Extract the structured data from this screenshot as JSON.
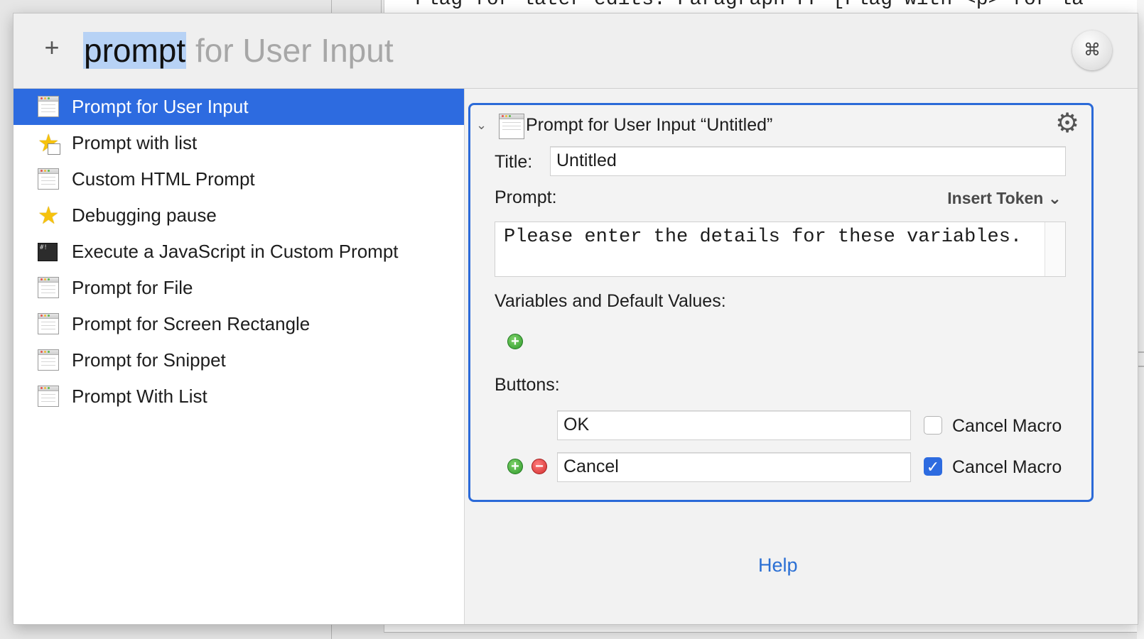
{
  "background": {
    "editor_line": "Flag for later edits: Paragraph  FP    [Flag with <p> for la"
  },
  "search": {
    "plus_label": "+",
    "typed": "prompt",
    "completion": " for User Input"
  },
  "app_icon_glyph": "⌘",
  "actions": [
    {
      "label": "Prompt for User Input",
      "icon": "window-icon",
      "selected": true
    },
    {
      "label": "Prompt with list",
      "icon": "star-icon",
      "selected": false
    },
    {
      "label": "Custom HTML Prompt",
      "icon": "window-icon",
      "selected": false
    },
    {
      "label": "Debugging pause",
      "icon": "star-icon",
      "selected": false
    },
    {
      "label": "Execute a JavaScript in Custom Prompt",
      "icon": "terminal-icon",
      "selected": false
    },
    {
      "label": "Prompt for File",
      "icon": "window-icon",
      "selected": false
    },
    {
      "label": "Prompt for Screen Rectangle",
      "icon": "window-icon",
      "selected": false
    },
    {
      "label": "Prompt for Snippet",
      "icon": "window-icon",
      "selected": false
    },
    {
      "label": "Prompt With List",
      "icon": "window-icon",
      "selected": false
    }
  ],
  "editor": {
    "header_title": "Prompt for User Input “Untitled”",
    "title_label": "Title:",
    "title_value": "Untitled",
    "prompt_label": "Prompt:",
    "insert_token_label": "Insert Token ⌄",
    "prompt_value": "Please enter the details for these variables.",
    "variables_label": "Variables and Default Values:",
    "buttons_label": "Buttons:",
    "buttons": [
      {
        "name": "OK",
        "cancel_label": "Cancel Macro",
        "cancel_checked": false
      },
      {
        "name": "Cancel",
        "cancel_label": "Cancel Macro",
        "cancel_checked": true
      }
    ]
  },
  "help_label": "Help",
  "colors": {
    "selection": "#2d6be0",
    "card_border": "#2b6ad8",
    "link": "#2a6fd4"
  }
}
